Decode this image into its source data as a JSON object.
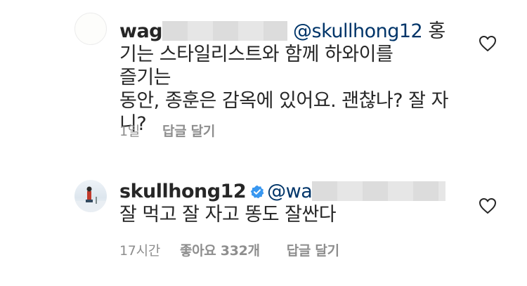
{
  "comments": [
    {
      "username": "wag",
      "mention": "@skullhong12",
      "text_lines": [
        "홍",
        "기는 스타일리스트와 함께 하와이를 즐기는",
        "동안, 종훈은 감옥에 있어요. 괜찮나? 잘 자",
        "니?"
      ],
      "time": "1일",
      "reply_label": "답글 달기",
      "like_icon": "heart-outline-icon"
    },
    {
      "username": "skullhong12",
      "verified_icon": "verified-badge-icon",
      "mention": "@wa",
      "text": "잘 먹고 잘 자고 똥도 잘싼다",
      "time": "17시간",
      "likes_label": "좋아요 332개",
      "reply_label": "답글 달기",
      "like_icon": "heart-outline-icon"
    }
  ],
  "colors": {
    "text": "#262626",
    "meta": "#8e8e8e",
    "mention": "#003569",
    "verified": "#3897f0"
  }
}
